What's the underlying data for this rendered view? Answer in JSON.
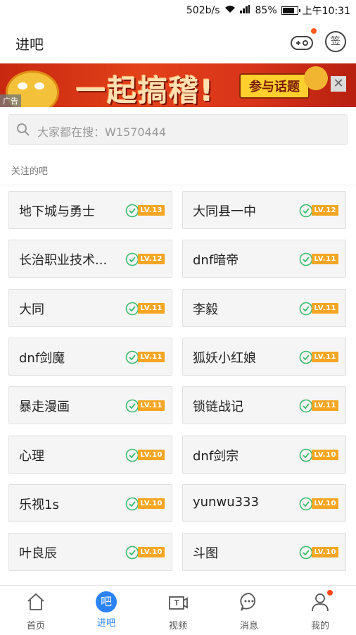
{
  "status_bar": {
    "speed": "502b/s",
    "battery": "85%",
    "time": "上午10:31"
  },
  "header": {
    "title": "进吧",
    "sign_label": "签"
  },
  "ad": {
    "headline": "一起搞稽!",
    "cta": "参与话题",
    "label": "广告",
    "close": "✕"
  },
  "search": {
    "placeholder": "大家都在搜：W1570444"
  },
  "section": {
    "title": "关注的吧"
  },
  "forums": [
    {
      "name": "地下城与勇士",
      "level": "LV.13"
    },
    {
      "name": "大同县一中",
      "level": "LV.12"
    },
    {
      "name": "长治职业技术...",
      "level": "LV.12"
    },
    {
      "name": "dnf暗帝",
      "level": "LV.11"
    },
    {
      "name": "大同",
      "level": "LV.11"
    },
    {
      "name": "李毅",
      "level": "LV.11"
    },
    {
      "name": "dnf剑魔",
      "level": "LV.11"
    },
    {
      "name": "狐妖小红娘",
      "level": "LV.11"
    },
    {
      "name": "暴走漫画",
      "level": "LV.11"
    },
    {
      "name": "锁链战记",
      "level": "LV.11"
    },
    {
      "name": "心理",
      "level": "LV.10"
    },
    {
      "name": "dnf剑宗",
      "level": "LV.10"
    },
    {
      "name": "乐视1s",
      "level": "LV.10"
    },
    {
      "name": "yunwu333",
      "level": "LV.10"
    },
    {
      "name": "叶良辰",
      "level": "LV.10"
    },
    {
      "name": "斗图",
      "level": "LV.10"
    }
  ],
  "tabs": [
    {
      "label": "首页",
      "icon": "home-icon"
    },
    {
      "label": "进吧",
      "icon": "forum-icon",
      "glyph": "吧"
    },
    {
      "label": "视频",
      "icon": "video-icon"
    },
    {
      "label": "消息",
      "icon": "message-icon"
    },
    {
      "label": "我的",
      "icon": "profile-icon"
    }
  ],
  "colors": {
    "accent": "#2b83f6",
    "level_badge": "#f6a623",
    "sign_green": "#3dbb6c",
    "notify_dot": "#ff5a1f"
  }
}
